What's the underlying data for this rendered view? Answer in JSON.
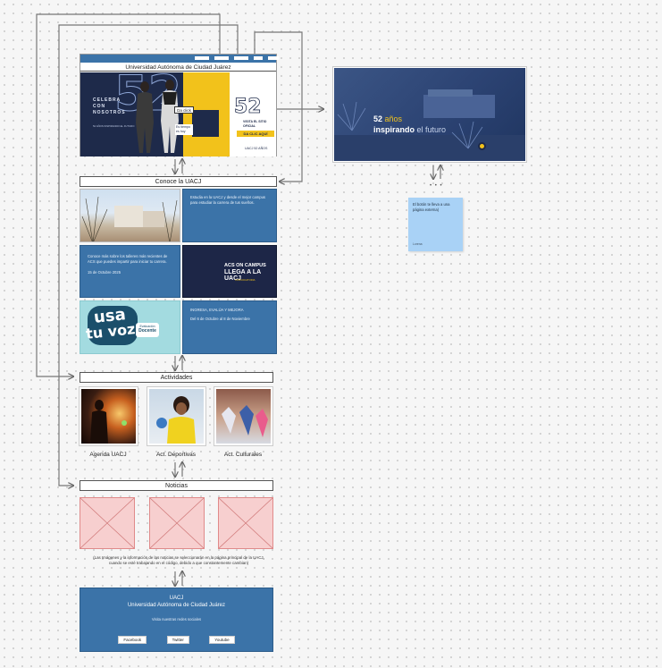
{
  "homepage": {
    "nav_items": [
      "",
      "",
      "",
      "",
      ""
    ],
    "title": "Universidad Autónoma de Ciudad Juárez",
    "hero": {
      "big_number": "52",
      "celebra": "CELEBRA CON NOSOTROS",
      "small_caption": "52 AÑOS INSPIRANDO EL FUTURO",
      "click_tag": "Da click",
      "en_tiempo": "Es tiempo es hoy",
      "visita": "VISITA EL SITIO OFICIAL",
      "da_clic": "DA CLIC AQUÍ",
      "logo": "UACJ 52 AÑOS"
    }
  },
  "preview": {
    "line1_number": "52",
    "line1_word": "años",
    "line2_bold": "inspirando",
    "line2_rest": "el futuro"
  },
  "ellipsis": "• • •",
  "sticky_note": {
    "text": "El botón te lleva a una página externa)",
    "author": "Lorena"
  },
  "conoce": {
    "title": "Conoce la UACJ",
    "card1_text": "Estudia en la UACJ y desde el mejor campus para estudiar la carrera de tus sueños.",
    "card2_text": "Conoce más sobre los talleres más recientes de ACS que puedes impartir para iniciar tu carrera.",
    "card2_date": "15 de Octubre 2025",
    "acs_banner": {
      "line1": "ACS ON CAMPUS",
      "line2": "LLEGA A LA UACJ",
      "sub": "CONVOCATORIA"
    },
    "usa_tu_voz": {
      "word1": "usa",
      "word2": "tu voz",
      "badge_top": "Evaluación",
      "badge_bottom": "Docente"
    },
    "card3_title": "INGRESA, EVALÚA Y MEJORA",
    "card3_dates": "Del 6 de Octubre al 8 de Noviembre"
  },
  "actividades": {
    "title": "Actividades",
    "items": [
      {
        "label": "Agenda UACJ"
      },
      {
        "label": "Act. Deportivas"
      },
      {
        "label": "Act. Culturales"
      }
    ]
  },
  "noticias": {
    "title": "Noticias",
    "note_line1": "(Las Imágenes y la información de las noticias se seleccionarán en la página principal de la UACJ,",
    "note_line2": "cuando se esté trabajando en el código,  debido a que constantemente cambian)"
  },
  "footer": {
    "title1": "UACJ",
    "title2": "Universidad Autónoma de Ciudad Juárez",
    "social_text": "Visita nuestras redes sociales",
    "buttons": [
      "Facebook",
      "Twitter",
      "Youtube"
    ]
  },
  "colors": {
    "brand_blue": "#3b73a8",
    "dark_navy": "#1e2a4a",
    "accent_yellow": "#f2c21b",
    "wireframe_pink": "#f7cfcf",
    "sticky_blue": "#a9d2f6"
  }
}
